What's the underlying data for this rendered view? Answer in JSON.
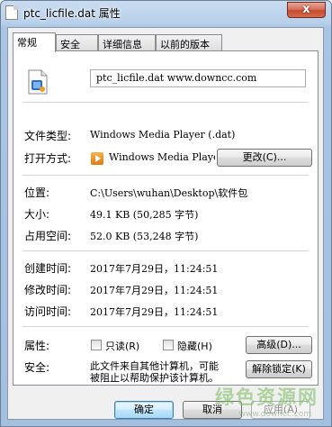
{
  "window": {
    "title": "ptc_licfile.dat 属性",
    "close_symbol": "x"
  },
  "tabs": [
    {
      "label": "常规",
      "active": true
    },
    {
      "label": "安全",
      "active": false
    },
    {
      "label": "详细信息",
      "active": false
    },
    {
      "label": "以前的版本",
      "active": false
    }
  ],
  "general": {
    "file_name": "ptc_licfile.dat  www.downcc.com",
    "file_type_label": "文件类型:",
    "file_type_value": "Windows Media Player (.dat)",
    "open_with_label": "打开方式:",
    "open_with_value": "Windows Media Playe",
    "change_button": "更改(C)...",
    "location_label": "位置:",
    "location_value": "C:\\Users\\wuhan\\Desktop\\软件包",
    "size_label": "大小:",
    "size_value": "49.1 KB (50,285 字节)",
    "size_on_disk_label": "占用空间:",
    "size_on_disk_value": "52.0 KB (53,248 字节)",
    "created_label": "创建时间:",
    "created_value": "2017年7月29日，11:24:51",
    "modified_label": "修改时间:",
    "modified_value": "2017年7月29日，11:24:51",
    "accessed_label": "访问时间:",
    "accessed_value": "2017年7月29日，11:24:51",
    "attributes_label": "属性:",
    "readonly_label": "只读(R)",
    "hidden_label": "隐藏(H)",
    "advanced_button": "高级(D)...",
    "security_label": "安全:",
    "security_text_line1": "此文件来自其他计算机，可能",
    "security_text_line2": "被阻止以帮助保护该计算机。",
    "unblock_button": "解除锁定(K)"
  },
  "footer": {
    "ok_button": "确定",
    "cancel_button": "取消",
    "apply_button": "应用(A)"
  },
  "watermark": {
    "text": "绿色资源网",
    "sub": "www.downcc.com"
  }
}
